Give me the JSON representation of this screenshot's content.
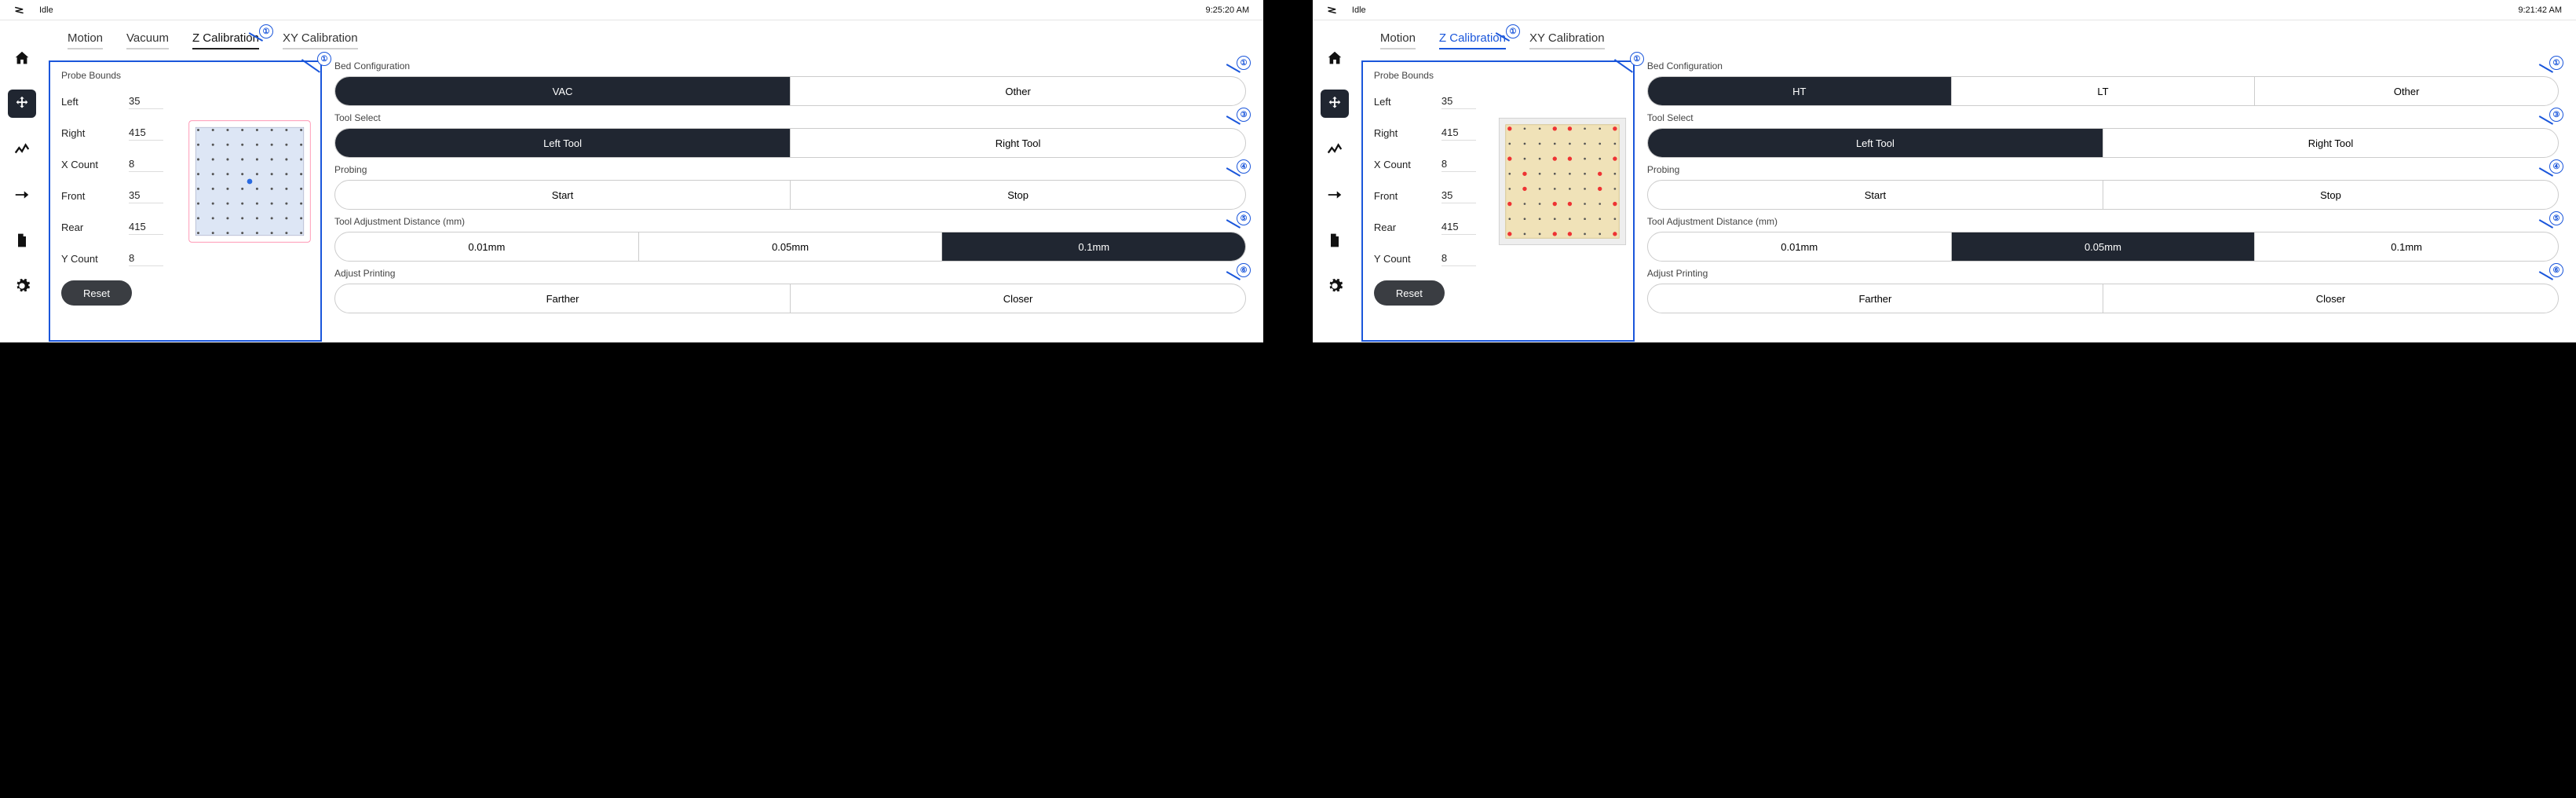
{
  "panels": [
    {
      "status": "Idle",
      "time": "9:25:20 AM",
      "tabs": [
        "Motion",
        "Vacuum",
        "Z Calibration",
        "XY Calibration"
      ],
      "active_tab": 2,
      "tab_style": "k",
      "tab_annotation": "①",
      "probe": {
        "title": "Probe Bounds",
        "annotation": "①",
        "fields": [
          {
            "label": "Left",
            "value": "35"
          },
          {
            "label": "Right",
            "value": "415"
          },
          {
            "label": "X Count",
            "value": "8"
          },
          {
            "label": "Front",
            "value": "35"
          },
          {
            "label": "Rear",
            "value": "415"
          },
          {
            "label": "Y Count",
            "value": "8"
          }
        ],
        "reset": "Reset",
        "viz": "blue"
      },
      "controls": [
        {
          "title": "Bed Configuration",
          "opts": [
            "VAC",
            "Other"
          ],
          "on": 0,
          "ann": "①"
        },
        {
          "title": "Tool Select",
          "opts": [
            "Left Tool",
            "Right Tool"
          ],
          "on": 0,
          "ann": "③"
        },
        {
          "title": "Probing",
          "opts": [
            "Start",
            "Stop"
          ],
          "on": -1,
          "ann": "④"
        },
        {
          "title": "Tool Adjustment Distance (mm)",
          "opts": [
            "0.01mm",
            "0.05mm",
            "0.1mm"
          ],
          "on": 2,
          "ann": "⑤"
        },
        {
          "title": "Adjust Printing",
          "opts": [
            "Farther",
            "Closer"
          ],
          "on": -1,
          "ann": "⑥"
        }
      ]
    },
    {
      "status": "Idle",
      "time": "9:21:42 AM",
      "tabs": [
        "Motion",
        "Z Calibration",
        "XY Calibration"
      ],
      "active_tab": 1,
      "tab_style": "b",
      "tab_annotation": "①",
      "probe": {
        "title": "Probe Bounds",
        "annotation": "①",
        "fields": [
          {
            "label": "Left",
            "value": "35"
          },
          {
            "label": "Right",
            "value": "415"
          },
          {
            "label": "X Count",
            "value": "8"
          },
          {
            "label": "Front",
            "value": "35"
          },
          {
            "label": "Rear",
            "value": "415"
          },
          {
            "label": "Y Count",
            "value": "8"
          }
        ],
        "reset": "Reset",
        "viz": "tan"
      },
      "controls": [
        {
          "title": "Bed Configuration",
          "opts": [
            "HT",
            "LT",
            "Other"
          ],
          "on": 0,
          "ann": "①"
        },
        {
          "title": "Tool Select",
          "opts": [
            "Left Tool",
            "Right Tool"
          ],
          "on": 0,
          "ann": "③"
        },
        {
          "title": "Probing",
          "opts": [
            "Start",
            "Stop"
          ],
          "on": -1,
          "ann": "④"
        },
        {
          "title": "Tool Adjustment Distance (mm)",
          "opts": [
            "0.01mm",
            "0.05mm",
            "0.1mm"
          ],
          "on": 1,
          "ann": "⑤"
        },
        {
          "title": "Adjust Printing",
          "opts": [
            "Farther",
            "Closer"
          ],
          "on": -1,
          "ann": "⑥"
        }
      ]
    }
  ]
}
